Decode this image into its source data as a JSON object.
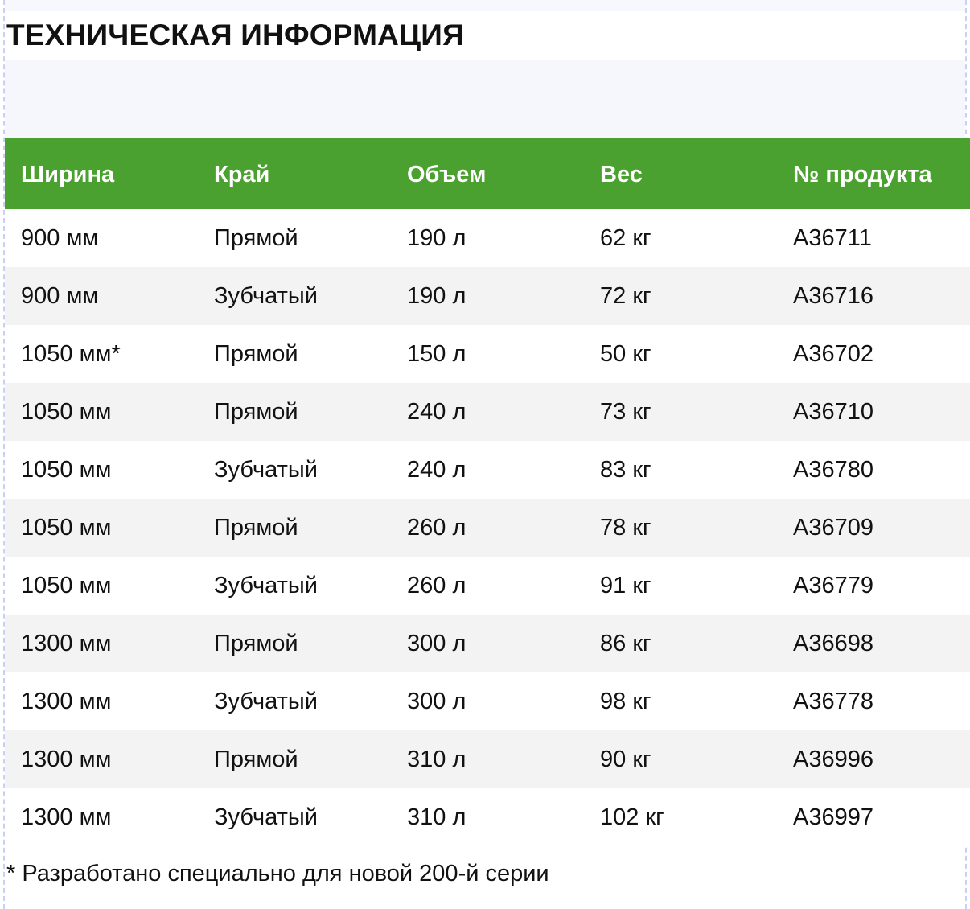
{
  "page": {
    "title": "ТЕХНИЧЕСКАЯ ИНФОРМАЦИЯ"
  },
  "table": {
    "header_bg": "#4ba12f",
    "columns": [
      "Ширина",
      "Край",
      "Объем",
      "Вес",
      "№ продукта"
    ],
    "rows": [
      [
        "900 мм",
        "Прямой",
        "190 л",
        "62 кг",
        "A36711"
      ],
      [
        "900 мм",
        "Зубчатый",
        "190 л",
        "72 кг",
        "A36716"
      ],
      [
        "1050 мм*",
        "Прямой",
        "150 л",
        "50 кг",
        "A36702"
      ],
      [
        "1050 мм",
        "Прямой",
        "240 л",
        "73 кг",
        "A36710"
      ],
      [
        "1050 мм",
        "Зубчатый",
        "240 л",
        "83 кг",
        "A36780"
      ],
      [
        "1050 мм",
        "Прямой",
        "260 л",
        "78 кг",
        "A36709"
      ],
      [
        "1050 мм",
        "Зубчатый",
        "260 л",
        "91 кг",
        "A36779"
      ],
      [
        "1300 мм",
        "Прямой",
        "300 л",
        "86 кг",
        "A36698"
      ],
      [
        "1300 мм",
        "Зубчатый",
        "300 л",
        "98 кг",
        "A36778"
      ],
      [
        "1300 мм",
        "Прямой",
        "310 л",
        "90 кг",
        "A36996"
      ],
      [
        "1300 мм",
        "Зубчатый",
        "310 л",
        "102 кг",
        "A36997"
      ]
    ]
  },
  "footnote": "* Разработано специально для новой 200-й серии"
}
